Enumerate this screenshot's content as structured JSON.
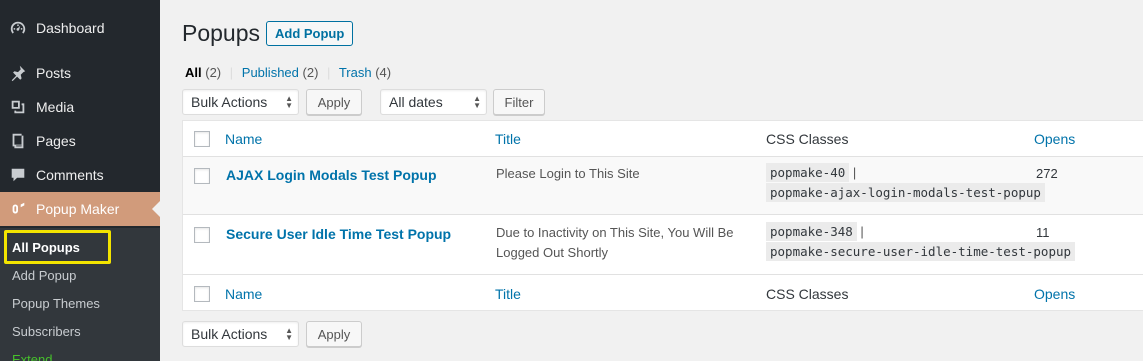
{
  "sidebar": {
    "items": [
      {
        "label": "Dashboard",
        "icon": "dashboard-icon"
      },
      {
        "label": "Posts",
        "icon": "pushpin-icon"
      },
      {
        "label": "Media",
        "icon": "media-icon"
      },
      {
        "label": "Pages",
        "icon": "pages-icon"
      },
      {
        "label": "Comments",
        "icon": "comments-icon"
      },
      {
        "label": "Popup Maker",
        "icon": "popup-maker-icon"
      }
    ],
    "submenu": [
      "All Popups",
      "Add Popup",
      "Popup Themes",
      "Subscribers",
      "Extend"
    ]
  },
  "header": {
    "title": "Popups",
    "add_button": "Add Popup"
  },
  "filters": {
    "views": [
      {
        "label": "All",
        "count": "(2)"
      },
      {
        "label": "Published",
        "count": "(2)"
      },
      {
        "label": "Trash",
        "count": "(4)"
      }
    ],
    "separator": "|",
    "bulk_actions": "Bulk Actions",
    "apply": "Apply",
    "all_dates": "All dates",
    "filter": "Filter"
  },
  "table": {
    "columns": [
      "Name",
      "Title",
      "CSS Classes",
      "Opens"
    ],
    "rows": [
      {
        "name": "AJAX Login Modals Test Popup",
        "title": "Please Login to This Site",
        "css_class_1": "popmake-40",
        "css_class_2": "popmake-ajax-login-modals-test-popup",
        "opens": "272"
      },
      {
        "name": "Secure User Idle Time Test Popup",
        "title": "Due to Inactivity on This Site, You Will Be Logged Out Shortly",
        "css_class_1": "popmake-348",
        "css_class_2": "popmake-secure-user-idle-time-test-popup",
        "opens": "11"
      }
    ]
  },
  "colors": {
    "sidebar_bg": "#23282d",
    "active_menu": "#d19b7b",
    "link": "#0073aa",
    "highlight": "#f3e400"
  }
}
